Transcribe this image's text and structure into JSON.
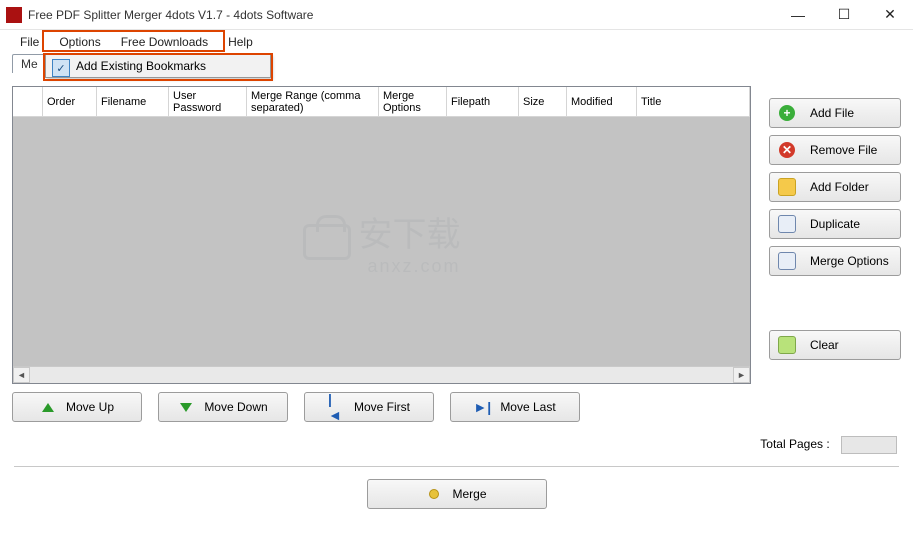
{
  "window": {
    "title": "Free PDF Splitter Merger 4dots V1.7 - 4dots Software"
  },
  "menu": {
    "file": "File",
    "options": "Options",
    "downloads": "Free Downloads",
    "help": "Help"
  },
  "tabs": {
    "merge_label_truncated": "Me"
  },
  "dropdown": {
    "item1": "Add Existing Bookmarks"
  },
  "grid": {
    "columns": [
      "",
      "Order",
      "Filename",
      "User Password",
      "Merge Range (comma separated)",
      "Merge Options",
      "Filepath",
      "Size",
      "Modified",
      "Title"
    ]
  },
  "watermark": {
    "main": "安下载",
    "sub": "anxz.com"
  },
  "move": {
    "up": "Move Up",
    "down": "Move Down",
    "first": "Move First",
    "last": "Move Last"
  },
  "side": {
    "add_file": "Add File",
    "remove_file": "Remove File",
    "add_folder": "Add Folder",
    "duplicate": "Duplicate",
    "merge_options": "Merge Options",
    "clear": "Clear"
  },
  "footer": {
    "total_pages": "Total Pages :",
    "merge": "Merge"
  }
}
